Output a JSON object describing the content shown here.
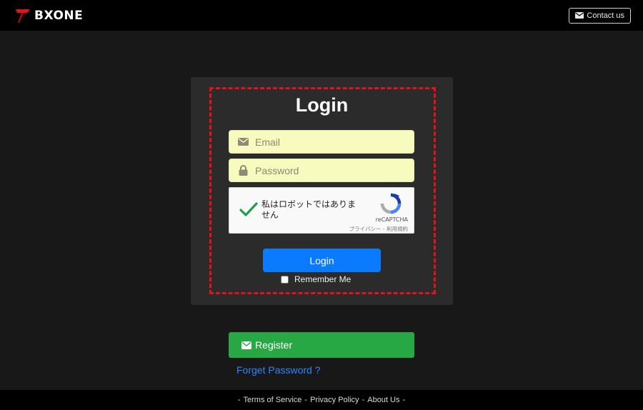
{
  "header": {
    "brand": "BXONE",
    "contact_label": "Contact us"
  },
  "login": {
    "title": "Login",
    "email_placeholder": "Email",
    "password_placeholder": "Password",
    "submit_label": "Login",
    "remember_label": "Remember Me",
    "remember_checked": false
  },
  "captcha": {
    "label": "私はロボットではありません",
    "checked": true,
    "brand": "reCAPTCHA",
    "privacy": "プライバシー",
    "separator": " - ",
    "terms": "利用規約"
  },
  "register_label": "Register",
  "forget_label": "Forget Password ?",
  "footer": {
    "prefix": "-",
    "terms": "Terms of Service",
    "sep1": "-",
    "privacy": "Privacy Policy",
    "sep2": "-",
    "about": "About Us",
    "suffix": "-"
  },
  "colors": {
    "accent_blue": "#0a7bff",
    "register_green": "#28a845",
    "highlight_red": "#e8101a",
    "input_bg": "#f7fbbd"
  }
}
